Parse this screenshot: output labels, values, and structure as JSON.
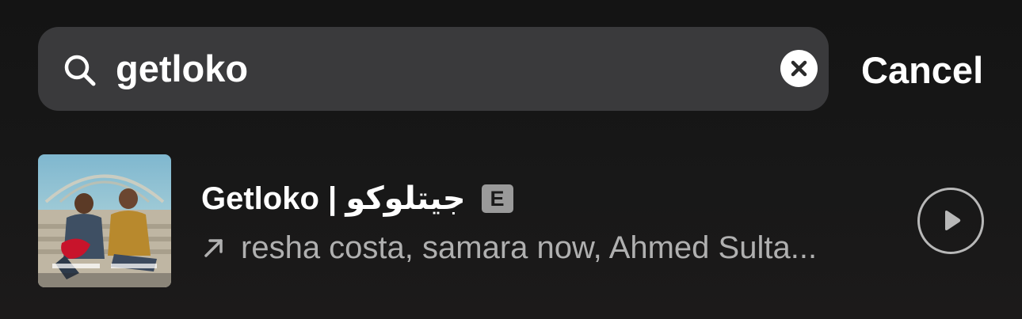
{
  "search": {
    "query": "getloko",
    "cancel_label": "Cancel"
  },
  "result": {
    "title": "Getloko | جيتلوكو",
    "explicit_label": "E",
    "artists": "resha costa, samara now, Ahmed Sulta..."
  },
  "icons": {
    "search": "search-icon",
    "clear": "close-circle-icon",
    "arrow": "arrow-up-right-icon",
    "play": "play-icon"
  },
  "colors": {
    "background": "#161616",
    "search_field": "#3a3a3c",
    "secondary_text": "#b0b0b0",
    "explicit_badge": "#9a9a9a"
  }
}
